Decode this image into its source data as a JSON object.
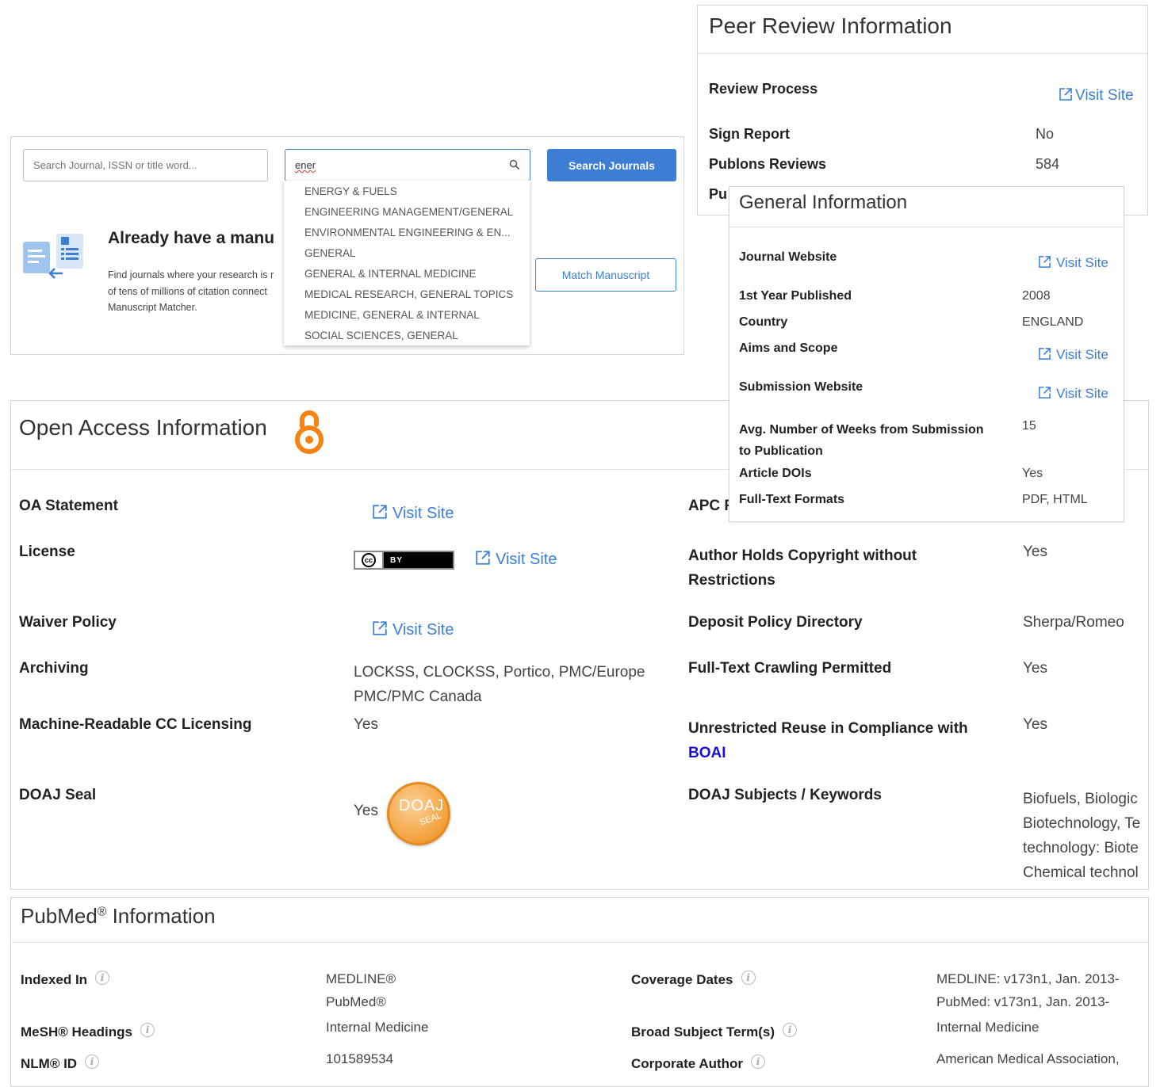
{
  "search": {
    "journal_placeholder": "Search Journal, ISSN or title word...",
    "category_value": "ener",
    "search_button": "Search Journals",
    "dropdown": [
      "ENERGY & FUELS",
      "ENGINEERING MANAGEMENT/GENERAL",
      "ENVIRONMENTAL ENGINEERING & EN...",
      "GENERAL",
      "GENERAL & INTERNAL MEDICINE",
      "MEDICAL RESEARCH, GENERAL TOPICS",
      "MEDICINE, GENERAL & INTERNAL",
      "SOCIAL SCIENCES, GENERAL"
    ],
    "manuscript_heading": "Already have a manu",
    "manuscript_desc": [
      "Find journals where your research is r",
      "of tens of millions of citation connect",
      "Manuscript Matcher."
    ],
    "match_button": "Match Manuscript"
  },
  "peer_review": {
    "title": "Peer Review Information",
    "rows": [
      {
        "label": "Review Process",
        "link": "Visit Site"
      },
      {
        "label": "Sign Report",
        "value": "No"
      },
      {
        "label": "Publons Reviews",
        "value": "584"
      },
      {
        "label": "Pu"
      }
    ]
  },
  "general": {
    "title": "General Information",
    "rows": [
      {
        "label": "Journal Website",
        "link": "Visit Site"
      },
      {
        "label": "1st Year Published",
        "value": "2008"
      },
      {
        "label": "Country",
        "value": "ENGLAND"
      },
      {
        "label": "Aims and Scope",
        "link": "Visit Site"
      },
      {
        "label": "Submission Website",
        "link": "Visit Site"
      },
      {
        "label": "Avg. Number of Weeks from Submission",
        "label2": "to Publication",
        "value": "15"
      },
      {
        "label": "Article DOIs",
        "value": "Yes"
      },
      {
        "label": "Full-Text Formats",
        "value": "PDF, HTML"
      }
    ]
  },
  "open_access": {
    "title": "Open Access Information",
    "left": [
      {
        "label": "OA Statement",
        "link": "Visit Site"
      },
      {
        "label": "License",
        "badge": "BY",
        "link": "Visit Site"
      },
      {
        "label": "Waiver Policy",
        "link": "Visit Site"
      },
      {
        "label": "Archiving",
        "value": "LOCKSS, CLOCKSS, Portico, PMC/Europe",
        "value2": "PMC/PMC Canada"
      },
      {
        "label": "Machine-Readable CC Licensing",
        "value": "Yes"
      },
      {
        "label": "DOAJ Seal",
        "value": "Yes",
        "seal": "DOAJ",
        "seal2": "SEAL"
      }
    ],
    "right": [
      {
        "label": "APC F"
      },
      {
        "label": "Author Holds Copyright without",
        "label2": "Restrictions",
        "value": "Yes"
      },
      {
        "label": "Deposit Policy Directory",
        "value": "Sherpa/Romeo"
      },
      {
        "label": "Full-Text Crawling Permitted",
        "value": "Yes"
      },
      {
        "label": "Unrestricted Reuse in Compliance with",
        "label2": "BOAI",
        "value": "Yes"
      },
      {
        "label": "DOAJ Subjects / Keywords",
        "values": [
          "Biofuels, Biologic",
          "Biotechnology, Te",
          "technology: Biote",
          "Chemical technol"
        ]
      }
    ]
  },
  "pubmed": {
    "title_main": "PubMed",
    "title_reg": "®",
    "title_rest": " Information",
    "left": [
      {
        "label": "Indexed In",
        "values": [
          "MEDLINE®",
          "PubMed®"
        ]
      },
      {
        "label": "MeSH® Headings",
        "values": [
          "Internal Medicine"
        ]
      },
      {
        "label": "NLM® ID",
        "values": [
          "101589534"
        ]
      }
    ],
    "right": [
      {
        "label": "Coverage Dates",
        "values": [
          "MEDLINE: v173n1, Jan. 2013-",
          "PubMed: v173n1, Jan. 2013-"
        ]
      },
      {
        "label": "Broad Subject Term(s)",
        "values": [
          "Internal Medicine"
        ]
      },
      {
        "label": "Corporate Author",
        "values": [
          "American Medical Association,"
        ]
      }
    ]
  },
  "colors": {
    "accent": "#3d7ed5",
    "oa_orange": "#f68212",
    "boai_link": "#1a0dde"
  }
}
